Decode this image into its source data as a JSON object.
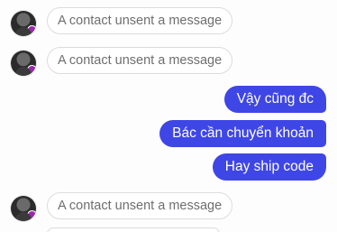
{
  "messages": [
    {
      "type": "unsent",
      "text": "A contact unsent a message"
    },
    {
      "type": "unsent",
      "text": "A contact unsent a message"
    },
    {
      "type": "outgoing",
      "text": "Vậy cũng đc"
    },
    {
      "type": "outgoing",
      "text": "Bác cần chuyển khoản"
    },
    {
      "type": "outgoing",
      "text": "Hay ship code"
    },
    {
      "type": "unsent",
      "text": "A contact unsent a message"
    }
  ],
  "colors": {
    "outgoing_bubble": "#3f46e6",
    "unsent_text": "#6e6e6e",
    "status_dot": "#9c27b0"
  }
}
